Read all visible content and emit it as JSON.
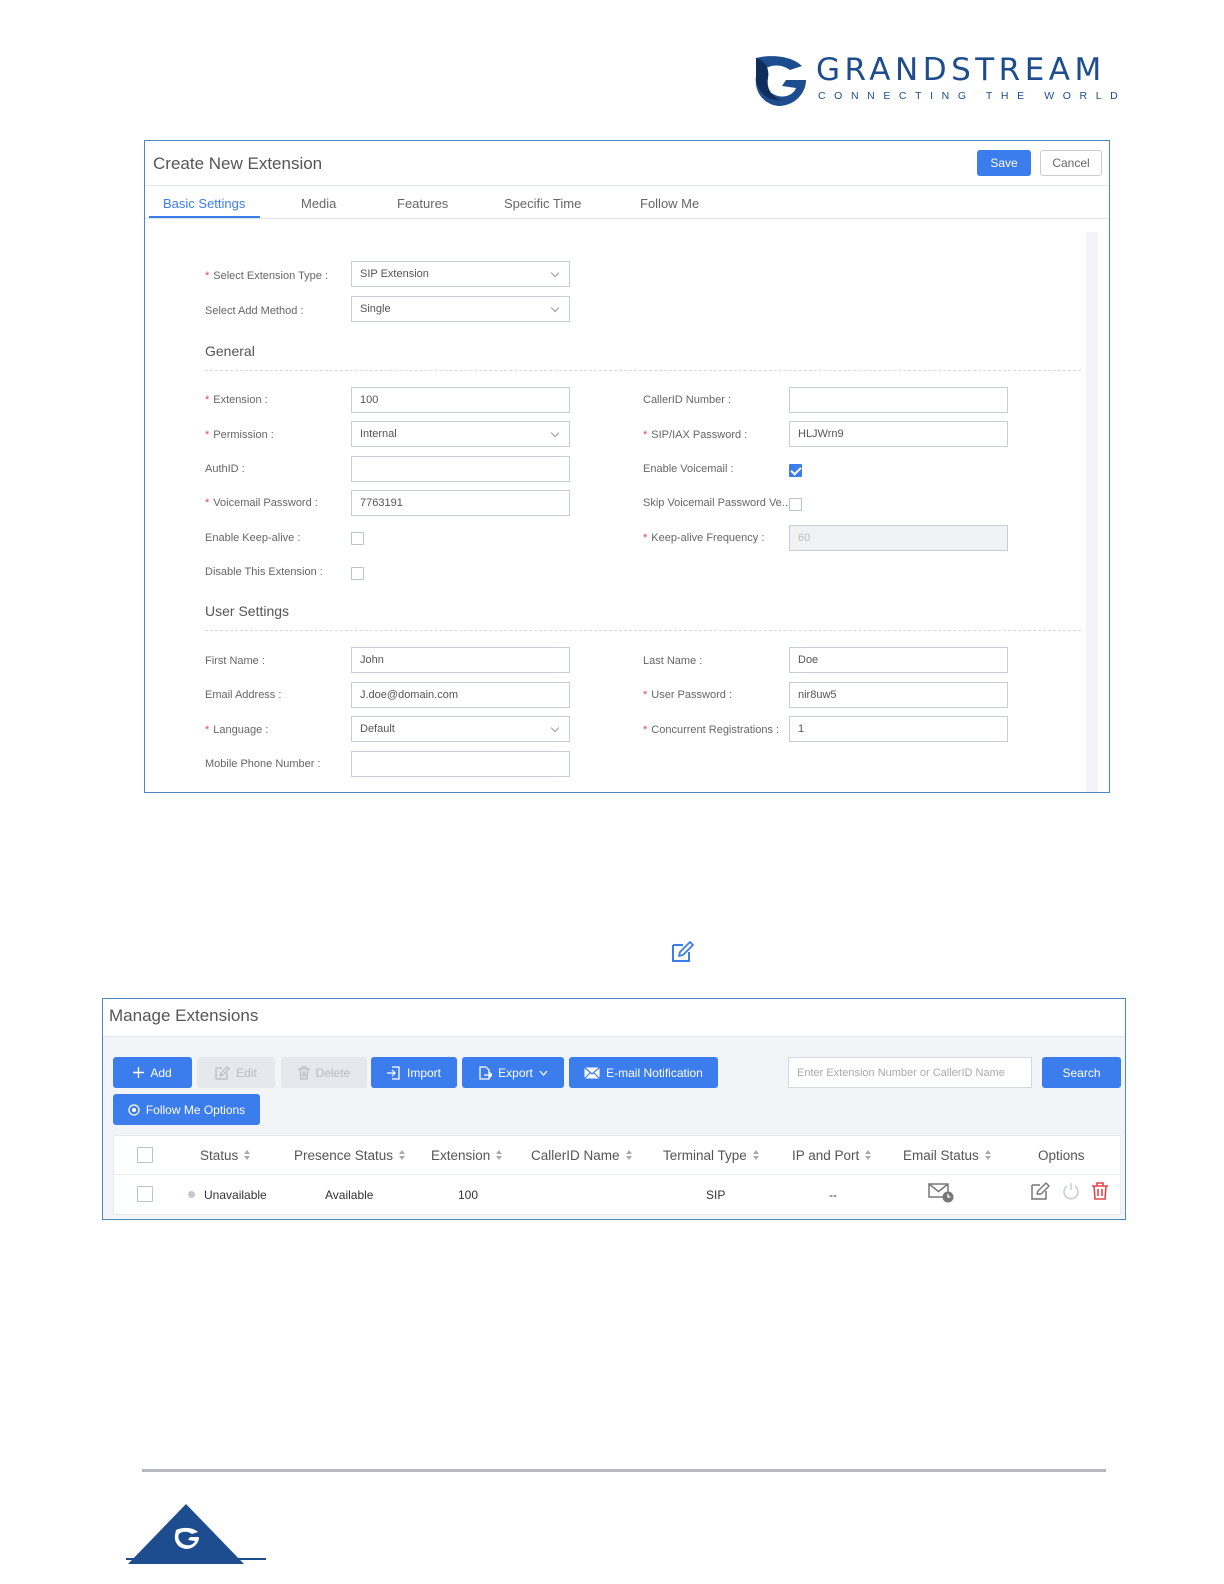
{
  "brand": {
    "name": "GRANDSTREAM",
    "tagline": "CONNECTING THE WORLD",
    "color": "#1d4d8e"
  },
  "create_extension": {
    "title": "Create New Extension",
    "save_label": "Save",
    "cancel_label": "Cancel",
    "tabs": [
      "Basic Settings",
      "Media",
      "Features",
      "Specific Time",
      "Follow Me"
    ],
    "active_tab": "Basic Settings",
    "fields": {
      "extension_type": {
        "label": "Select Extension Type :",
        "value": "SIP Extension"
      },
      "add_method": {
        "label": "Select Add Method :",
        "value": "Single"
      },
      "extension": {
        "label": "Extension :",
        "value": "100"
      },
      "callerid_number": {
        "label": "CallerID Number :",
        "value": ""
      },
      "permission": {
        "label": "Permission :",
        "value": "Internal"
      },
      "sip_password": {
        "label": "SIP/IAX Password :",
        "value": "HLJWrn9"
      },
      "authid": {
        "label": "AuthID :",
        "value": ""
      },
      "enable_voicemail": {
        "label": "Enable Voicemail :",
        "checked": true
      },
      "voicemail_password": {
        "label": "Voicemail Password :",
        "value": "7763191"
      },
      "skip_voicemail": {
        "label": "Skip Voicemail Password Ve...",
        "checked": false
      },
      "enable_keepalive": {
        "label": "Enable Keep-alive :",
        "checked": false
      },
      "keepalive_frequency": {
        "label": "Keep-alive Frequency :",
        "value": "60"
      },
      "disable_extension": {
        "label": "Disable This Extension :",
        "checked": false
      },
      "first_name": {
        "label": "First Name :",
        "value": "John"
      },
      "last_name": {
        "label": "Last Name :",
        "value": "Doe"
      },
      "email": {
        "label": "Email Address :",
        "value": "J.doe@domain.com"
      },
      "user_password": {
        "label": "User Password :",
        "value": "nir8uw5"
      },
      "language": {
        "label": "Language :",
        "value": "Default"
      },
      "concurrent_registrations": {
        "label": "Concurrent Registrations :",
        "value": "1"
      },
      "mobile_phone": {
        "label": "Mobile Phone Number :",
        "value": ""
      }
    },
    "sections": {
      "general": "General",
      "user_settings": "User Settings"
    },
    "required_mark": "*"
  },
  "manage_extensions": {
    "title": "Manage Extensions",
    "toolbar": {
      "add": "Add",
      "edit": "Edit",
      "delete": "Delete",
      "import": "Import",
      "export": "Export",
      "email_notification": "E-mail Notification",
      "follow_me_options": "Follow Me Options",
      "search_placeholder": "Enter Extension Number or CallerID Name",
      "search": "Search"
    },
    "columns": [
      "Status",
      "Presence Status",
      "Extension",
      "CallerID Name",
      "Terminal Type",
      "IP and Port",
      "Email Status",
      "Options"
    ],
    "rows": [
      {
        "status": "Unavailable",
        "presence": "Available",
        "extension": "100",
        "callerid_name": "",
        "terminal_type": "SIP",
        "ip_port": "--"
      }
    ]
  },
  "colors": {
    "accent": "#3b7ded",
    "required": "#e2464c",
    "delete": "#e2464c",
    "panel_border": "#4b87c3"
  }
}
